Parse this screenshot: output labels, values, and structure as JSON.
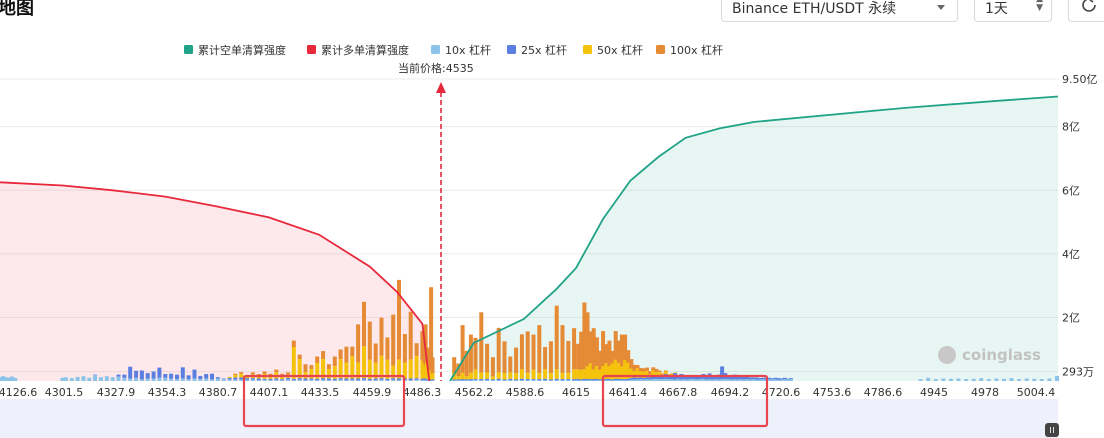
{
  "header": {
    "title": "地图",
    "pair_select": "Binance ETH/USDT 永续",
    "timeframe_select": "1天"
  },
  "watermark": "coinglass",
  "colors": {
    "cum_short": "#20a386",
    "cum_long": "#e8283b",
    "lev10": "#8cc3e9",
    "lev25": "#5b7fe1",
    "lev50": "#f5c20c",
    "lev100": "#e58a35",
    "annotation_box": "#e8464f",
    "price_line": "#e8283b",
    "plot_bg": "#ffffff",
    "bottom_band": "#eef1fb"
  },
  "chart_data": {
    "type": "bar",
    "title": "",
    "current_price_label": "当前价格:4535",
    "current_price": 4535,
    "legend_position": "top-center",
    "grid": true,
    "legend": [
      {
        "key": "cum_short",
        "label": "累计空单清算强度"
      },
      {
        "key": "cum_long",
        "label": "累计多单清算强度"
      },
      {
        "key": "lev10",
        "label": "10x 杠杆"
      },
      {
        "key": "lev25",
        "label": "25x 杠杆"
      },
      {
        "key": "lev50",
        "label": "50x 杠杆"
      },
      {
        "key": "lev100",
        "label": "100x 杠杆"
      }
    ],
    "x_tick_labels": [
      "4126.6",
      "4301.5",
      "4327.9",
      "4354.3",
      "4380.7",
      "4407.1",
      "4433.5",
      "4459.9",
      "4486.3",
      "4562.2",
      "4588.6",
      "4615",
      "4641.4",
      "4667.8",
      "4694.2",
      "4720.6",
      "4753.6",
      "4786.6",
      "4945",
      "4978",
      "5004.4"
    ],
    "y_right_ticks": [
      {
        "value": 29300000,
        "label": "293万"
      },
      {
        "value": 200000000,
        "label": "2亿"
      },
      {
        "value": 400000000,
        "label": "4亿"
      },
      {
        "value": 600000000,
        "label": "6亿"
      },
      {
        "value": 800000000,
        "label": "8亿"
      },
      {
        "value": 950000000,
        "label": "9.50亿"
      }
    ],
    "ylim": [
      0,
      950000000
    ],
    "annotations": [
      {
        "type": "box",
        "ticks": [
          "4407.1",
          "4433.5",
          "4459.9"
        ]
      },
      {
        "type": "box",
        "ticks": [
          "4641.4",
          "4667.8",
          "4694.2"
        ]
      }
    ],
    "cumulative_long": [
      {
        "x": 4120,
        "y": 625
      },
      {
        "x": 4301,
        "y": 615
      },
      {
        "x": 4327,
        "y": 600
      },
      {
        "x": 4354,
        "y": 580
      },
      {
        "x": 4380,
        "y": 550
      },
      {
        "x": 4407,
        "y": 515
      },
      {
        "x": 4433,
        "y": 460
      },
      {
        "x": 4459,
        "y": 360
      },
      {
        "x": 4473,
        "y": 280
      },
      {
        "x": 4486,
        "y": 180
      },
      {
        "x": 4500,
        "y": 0
      }
    ],
    "cumulative_short": [
      {
        "x": 4545,
        "y": 0
      },
      {
        "x": 4562,
        "y": 120
      },
      {
        "x": 4588,
        "y": 195
      },
      {
        "x": 4605,
        "y": 290
      },
      {
        "x": 4615,
        "y": 355
      },
      {
        "x": 4641,
        "y": 510
      },
      {
        "x": 4667,
        "y": 630
      },
      {
        "x": 4694,
        "y": 705
      },
      {
        "x": 4720,
        "y": 765
      },
      {
        "x": 4753,
        "y": 795
      },
      {
        "x": 4786,
        "y": 815
      },
      {
        "x": 4945,
        "y": 860
      },
      {
        "x": 4978,
        "y": 880
      },
      {
        "x": 5004.4,
        "y": 895
      }
    ],
    "bars_note": "per-price stacked heights in 亿 units are listed in bars (x in USDT, values for 10x/25x/50x/100x)",
    "bars": [
      [
        4120,
        0.12,
        0,
        0,
        0
      ],
      [
        4124,
        0.1,
        0,
        0,
        0
      ],
      [
        4129,
        0.15,
        0,
        0,
        0
      ],
      [
        4134,
        0.1,
        0,
        0,
        0
      ],
      [
        4139,
        0.12,
        0,
        0,
        0
      ],
      [
        4144,
        0.08,
        0,
        0,
        0
      ],
      [
        4149,
        0.1,
        0,
        0,
        0
      ],
      [
        4154,
        0.14,
        0,
        0,
        0
      ],
      [
        4159,
        0.1,
        0,
        0,
        0
      ],
      [
        4164,
        0.09,
        0,
        0,
        0
      ],
      [
        4300,
        0.1,
        0,
        0,
        0
      ],
      [
        4303,
        0.12,
        0,
        0,
        0
      ],
      [
        4306,
        0.09,
        0,
        0,
        0
      ],
      [
        4309,
        0.13,
        0,
        0,
        0
      ],
      [
        4312,
        0.15,
        0,
        0,
        0
      ],
      [
        4315,
        0.1,
        0,
        0,
        0
      ],
      [
        4318,
        0.18,
        0.02,
        0,
        0
      ],
      [
        4321,
        0.12,
        0,
        0,
        0
      ],
      [
        4324,
        0.15,
        0,
        0,
        0
      ],
      [
        4327,
        0.12,
        0,
        0,
        0
      ],
      [
        4330,
        0.14,
        0.06,
        0,
        0
      ],
      [
        4333,
        0.1,
        0.1,
        0,
        0
      ],
      [
        4336,
        0.08,
        0.37,
        0,
        0
      ],
      [
        4339,
        0.1,
        0.22,
        0,
        0
      ],
      [
        4342,
        0.05,
        0.28,
        0,
        0
      ],
      [
        4345,
        0.08,
        0.17,
        0,
        0
      ],
      [
        4348,
        0.08,
        0.22,
        0,
        0
      ],
      [
        4351,
        0.1,
        0.32,
        0,
        0
      ],
      [
        4354,
        0.1,
        0.12,
        0,
        0
      ],
      [
        4357,
        0.08,
        0.15,
        0,
        0
      ],
      [
        4360,
        0.06,
        0.14,
        0,
        0
      ],
      [
        4363,
        0.08,
        0.35,
        0,
        0
      ],
      [
        4366,
        0.06,
        0.12,
        0,
        0
      ],
      [
        4369,
        0.08,
        0.28,
        0,
        0
      ],
      [
        4372,
        0.06,
        0.1,
        0,
        0
      ],
      [
        4375,
        0.08,
        0.14,
        0,
        0
      ],
      [
        4378,
        0.05,
        0.18,
        0,
        0
      ],
      [
        4381,
        0.08,
        0.04,
        0,
        0
      ],
      [
        4384,
        0.06,
        0.02,
        0,
        0
      ],
      [
        4387,
        0.05,
        0.05,
        0.03,
        0
      ],
      [
        4390,
        0.04,
        0.07,
        0.08,
        0.04
      ],
      [
        4393,
        0.05,
        0.06,
        0.12,
        0.05
      ],
      [
        4396,
        0.04,
        0.05,
        0.09,
        0
      ],
      [
        4399,
        0.05,
        0.04,
        0.12,
        0.06
      ],
      [
        4402,
        0.03,
        0.05,
        0.1,
        0.04
      ],
      [
        4405,
        0.04,
        0.03,
        0.15,
        0.08
      ],
      [
        4408,
        0.03,
        0.04,
        0.1,
        0.06
      ],
      [
        4411,
        0.04,
        0.04,
        0.2,
        0.08
      ],
      [
        4414,
        0.03,
        0.03,
        0.12,
        0.05
      ],
      [
        4417,
        0.05,
        0.05,
        0.1,
        0.07
      ],
      [
        4420,
        0.03,
        0.04,
        1.0,
        0.2
      ],
      [
        4423,
        0.04,
        0.05,
        0.6,
        0.14
      ],
      [
        4426,
        0.03,
        0.05,
        0.2,
        0.25
      ],
      [
        4429,
        0.04,
        0.04,
        0.3,
        0.12
      ],
      [
        4432,
        0.03,
        0.04,
        0.5,
        0.2
      ],
      [
        4435,
        0.04,
        0.05,
        0.6,
        0.25
      ],
      [
        4438,
        0.03,
        0.05,
        0.3,
        0.15
      ],
      [
        4441,
        0.03,
        0.04,
        0.4,
        0.3
      ],
      [
        4444,
        0.04,
        0.05,
        0.6,
        0.3
      ],
      [
        4447,
        0.03,
        0.05,
        0.5,
        0.5
      ],
      [
        4450,
        0.04,
        0.04,
        0.7,
        0.3
      ],
      [
        4453,
        0.03,
        0.05,
        0.5,
        1.2
      ],
      [
        4456,
        0.04,
        0.05,
        1.0,
        1.4
      ],
      [
        4459,
        0.03,
        0.04,
        0.6,
        1.2
      ],
      [
        4462,
        0.03,
        0.05,
        0.5,
        0.6
      ],
      [
        4465,
        0.04,
        0.05,
        0.7,
        1.2
      ],
      [
        4468,
        0.03,
        0.04,
        0.6,
        0.7
      ],
      [
        4471,
        0.04,
        0.05,
        0.4,
        1.6
      ],
      [
        4474,
        0.03,
        0.05,
        0.6,
        2.5
      ],
      [
        4477,
        0.04,
        0.04,
        0.5,
        0.9
      ],
      [
        4480,
        0.03,
        0.05,
        0.6,
        1.5
      ],
      [
        4483,
        0.04,
        0.05,
        0.7,
        0.4
      ],
      [
        4486,
        0.03,
        0.04,
        0.6,
        0.9
      ],
      [
        4489,
        0.03,
        0.05,
        0.5,
        0.3
      ],
      [
        4492,
        0.04,
        0.04,
        0.4,
        1.3
      ],
      [
        4495,
        0.03,
        0.05,
        0.5,
        0.2
      ],
      [
        4498,
        0.02,
        0.03,
        0.4,
        0.6
      ],
      [
        4501,
        0.02,
        0.03,
        0.3,
        0.4
      ],
      [
        4504,
        0.02,
        0.03,
        0.3,
        2.6
      ],
      [
        4507,
        0.02,
        0.03,
        0.2,
        0.5
      ],
      [
        4548,
        0.02,
        0.03,
        0.2,
        0.5
      ],
      [
        4551,
        0.02,
        0.03,
        0.1,
        0.4
      ],
      [
        4554,
        0.02,
        0.04,
        0.2,
        1.5
      ],
      [
        4557,
        0.02,
        0.03,
        0.1,
        0.8
      ],
      [
        4560,
        0.02,
        0.04,
        0.2,
        1.2
      ],
      [
        4563,
        0.03,
        0.03,
        0.3,
        1.0
      ],
      [
        4566,
        0.02,
        0.04,
        0.2,
        1.9
      ],
      [
        4569,
        0.03,
        0.04,
        0.2,
        0.9
      ],
      [
        4572,
        0.02,
        0.03,
        0.1,
        0.6
      ],
      [
        4575,
        0.03,
        0.04,
        0.2,
        1.4
      ],
      [
        4578,
        0.02,
        0.03,
        0.2,
        1.0
      ],
      [
        4581,
        0.03,
        0.04,
        0.2,
        0.5
      ],
      [
        4584,
        0.02,
        0.03,
        0.2,
        0.8
      ],
      [
        4587,
        0.03,
        0.04,
        0.3,
        1.1
      ],
      [
        4590,
        0.02,
        0.04,
        0.2,
        1.3
      ],
      [
        4593,
        0.03,
        0.03,
        0.3,
        1.1
      ],
      [
        4596,
        0.02,
        0.04,
        0.2,
        1.5
      ],
      [
        4599,
        0.03,
        0.04,
        0.3,
        0.7
      ],
      [
        4602,
        0.02,
        0.03,
        0.2,
        1.0
      ],
      [
        4605,
        0.03,
        0.04,
        0.3,
        2.0
      ],
      [
        4608,
        0.02,
        0.04,
        0.2,
        1.5
      ],
      [
        4611,
        0.03,
        0.03,
        0.2,
        1.0
      ],
      [
        4614,
        0.02,
        0.04,
        0.3,
        1.3
      ],
      [
        4617,
        0.03,
        0.04,
        0.3,
        0.8
      ],
      [
        4620,
        0.02,
        0.03,
        0.3,
        1.2
      ],
      [
        4623,
        0.03,
        0.04,
        0.3,
        2.1
      ],
      [
        4626,
        0.02,
        0.04,
        0.4,
        1.7
      ],
      [
        4629,
        0.03,
        0.03,
        0.5,
        1.0
      ],
      [
        4632,
        0.02,
        0.04,
        0.3,
        1.3
      ],
      [
        4635,
        0.03,
        0.04,
        0.4,
        0.9
      ],
      [
        4638,
        0.02,
        0.03,
        0.3,
        0.6
      ],
      [
        4641,
        0.03,
        0.04,
        0.4,
        1.1
      ],
      [
        4644,
        0.02,
        0.04,
        0.5,
        0.6
      ],
      [
        4647,
        0.03,
        0.04,
        0.4,
        0.8
      ],
      [
        4650,
        0.02,
        0.03,
        0.5,
        0.4
      ],
      [
        4653,
        0.03,
        0.04,
        0.6,
        0.9
      ],
      [
        4656,
        0.03,
        0.04,
        0.5,
        0.7
      ],
      [
        4659,
        0.03,
        0.03,
        0.4,
        1.0
      ],
      [
        4662,
        0.02,
        0.04,
        0.6,
        0.8
      ],
      [
        4665,
        0.03,
        0.04,
        0.5,
        0.4
      ],
      [
        4668,
        0.04,
        0.05,
        0.3,
        0.3
      ],
      [
        4671,
        0.05,
        0.06,
        0.2,
        0.2
      ],
      [
        4674,
        0.05,
        0.05,
        0.3,
        0.1
      ],
      [
        4677,
        0.06,
        0.05,
        0.2,
        0.1
      ],
      [
        4680,
        0.05,
        0.05,
        0.2,
        0.1
      ],
      [
        4683,
        0.06,
        0.06,
        0.2,
        0.1
      ],
      [
        4686,
        0.05,
        0.06,
        0.1,
        0.1
      ],
      [
        4689,
        0.06,
        0.07,
        0.2,
        0.1
      ],
      [
        4692,
        0.07,
        0.06,
        0.15,
        0.1
      ],
      [
        4695,
        0.06,
        0.12,
        0.1,
        0.05
      ],
      [
        4698,
        0.06,
        0.1,
        0.05,
        0.03
      ],
      [
        4701,
        0.07,
        0.15,
        0.08,
        0.03
      ],
      [
        4704,
        0.06,
        0.08,
        0.05,
        0.02
      ],
      [
        4707,
        0.06,
        0.12,
        0.04,
        0.02
      ],
      [
        4710,
        0.05,
        0.2,
        0.02,
        0
      ],
      [
        4713,
        0.07,
        0.1,
        0,
        0
      ],
      [
        4716,
        0.05,
        0.17,
        0,
        0
      ],
      [
        4719,
        0.06,
        0.12,
        0,
        0
      ],
      [
        4722,
        0.05,
        0.1,
        0,
        0
      ],
      [
        4725,
        0.06,
        0.08,
        0,
        0
      ],
      [
        4728,
        0.07,
        0.1,
        0,
        0
      ],
      [
        4731,
        0.05,
        0.12,
        0,
        0
      ],
      [
        4734,
        0.06,
        0.08,
        0,
        0
      ],
      [
        4737,
        0.07,
        0.15,
        0,
        0
      ],
      [
        4740,
        0.05,
        0.1,
        0,
        0
      ],
      [
        4743,
        0.06,
        0.18,
        0,
        0
      ],
      [
        4746,
        0.05,
        0.08,
        0,
        0
      ],
      [
        4749,
        0.06,
        0.1,
        0,
        0
      ],
      [
        4752,
        0.05,
        0.15,
        0,
        0
      ],
      [
        4755,
        0.06,
        0.4,
        0,
        0
      ],
      [
        4758,
        0.07,
        0.18,
        0,
        0
      ],
      [
        4761,
        0.06,
        0.12,
        0,
        0
      ],
      [
        4764,
        0.05,
        0.1,
        0,
        0
      ],
      [
        4767,
        0.06,
        0.14,
        0,
        0
      ],
      [
        4770,
        0.05,
        0.08,
        0,
        0
      ],
      [
        4773,
        0.06,
        0.12,
        0,
        0
      ],
      [
        4776,
        0.05,
        0.1,
        0,
        0
      ],
      [
        4779,
        0.06,
        0.08,
        0,
        0
      ],
      [
        4782,
        0.05,
        0.06,
        0,
        0
      ],
      [
        4785,
        0.06,
        0.05,
        0,
        0
      ],
      [
        4788,
        0.05,
        0.06,
        0,
        0
      ],
      [
        4791,
        0.04,
        0.05,
        0,
        0
      ],
      [
        4794,
        0.06,
        0.04,
        0,
        0
      ],
      [
        4797,
        0.05,
        0.05,
        0,
        0
      ],
      [
        4800,
        0.06,
        0.04,
        0,
        0
      ],
      [
        4803,
        0.05,
        0.03,
        0,
        0
      ],
      [
        4806,
        0.06,
        0.04,
        0,
        0
      ],
      [
        4809,
        0.04,
        0.05,
        0,
        0
      ],
      [
        4812,
        0.05,
        0.03,
        0,
        0
      ],
      [
        4815,
        0.06,
        0.04,
        0,
        0
      ],
      [
        4818,
        0.05,
        0.02,
        0,
        0
      ],
      [
        4821,
        0.06,
        0.03,
        0,
        0
      ],
      [
        4950,
        0.06,
        0,
        0,
        0
      ],
      [
        4953,
        0.1,
        0,
        0,
        0
      ],
      [
        4956,
        0.06,
        0,
        0,
        0
      ],
      [
        4959,
        0.08,
        0,
        0,
        0
      ],
      [
        4962,
        0.07,
        0,
        0,
        0
      ],
      [
        4965,
        0.08,
        0,
        0,
        0
      ],
      [
        4968,
        0.06,
        0,
        0,
        0
      ],
      [
        4971,
        0.07,
        0,
        0,
        0
      ],
      [
        4974,
        0.09,
        0,
        0,
        0
      ],
      [
        4977,
        0.06,
        0,
        0,
        0
      ],
      [
        4980,
        0.08,
        0,
        0,
        0
      ],
      [
        4983,
        0.07,
        0,
        0,
        0
      ],
      [
        4986,
        0.09,
        0,
        0,
        0
      ],
      [
        4989,
        0.06,
        0,
        0,
        0
      ],
      [
        4992,
        0.08,
        0,
        0,
        0
      ],
      [
        4995,
        0.07,
        0,
        0,
        0
      ],
      [
        4998,
        0.06,
        0,
        0,
        0
      ],
      [
        5001,
        0.08,
        0,
        0,
        0
      ],
      [
        5004,
        0.16,
        0,
        0,
        0
      ]
    ]
  }
}
